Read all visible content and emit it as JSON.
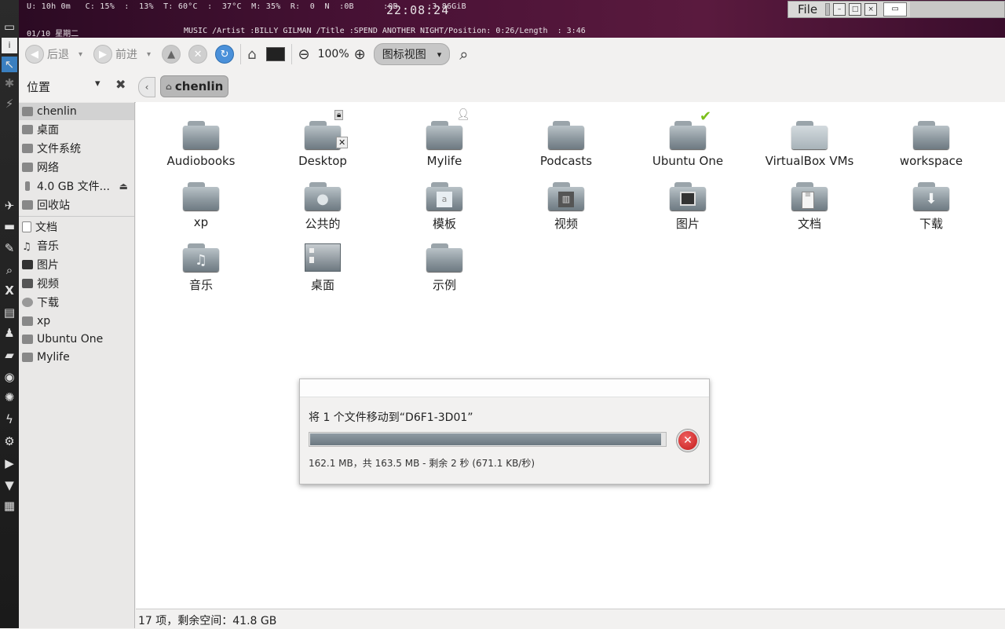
{
  "topbar": {
    "stats": "U: 10h 0m   C: 15%  :  13%  T: 60°C  :  37°C  M: 35%  R:  0  N  :0B      :0B      :3.86GiB",
    "clock": "22:08:24",
    "date": "01/10  星期二",
    "music": "MUSIC /Artist :BILLY GILMAN /Title :SPEND ANOTHER NIGHT/Position: 0:26/Length  : 3:46"
  },
  "menubar": {
    "file_label": "File"
  },
  "toolbar": {
    "back_label": "后退",
    "forward_label": "前进",
    "zoom_level": "100%",
    "view_mode": "图标视图"
  },
  "location": {
    "places_title": "位置",
    "crumb": "chenlin"
  },
  "sidebar": {
    "items": [
      {
        "label": "chenlin",
        "icon": "home-folder-icon"
      },
      {
        "label": "桌面",
        "icon": "desktop-icon"
      },
      {
        "label": "文件系统",
        "icon": "filesystem-icon"
      },
      {
        "label": "网络",
        "icon": "network-icon"
      },
      {
        "label": "4.0 GB 文件...",
        "icon": "usb-drive-icon"
      },
      {
        "label": "回收站",
        "icon": "trash-icon"
      },
      {
        "label": "文档",
        "icon": "documents-icon"
      },
      {
        "label": "音乐",
        "icon": "music-icon"
      },
      {
        "label": "图片",
        "icon": "pictures-icon"
      },
      {
        "label": "视频",
        "icon": "videos-icon"
      },
      {
        "label": "下载",
        "icon": "downloads-icon"
      },
      {
        "label": "xp",
        "icon": "folder-icon"
      },
      {
        "label": "Ubuntu One",
        "icon": "folder-icon"
      },
      {
        "label": "Mylife",
        "icon": "folder-icon"
      }
    ]
  },
  "files": [
    {
      "name": "Audiobooks",
      "icon": "folder-icon"
    },
    {
      "name": "Desktop",
      "icon": "folder-icon"
    },
    {
      "name": "Mylife",
      "icon": "folder-icon"
    },
    {
      "name": "Podcasts",
      "icon": "folder-icon"
    },
    {
      "name": "Ubuntu One",
      "icon": "folder-icon"
    },
    {
      "name": "VirtualBox VMs",
      "icon": "folder-icon"
    },
    {
      "name": "workspace",
      "icon": "folder-icon"
    },
    {
      "name": "xp",
      "icon": "folder-icon"
    },
    {
      "name": "公共的",
      "icon": "public-folder-icon"
    },
    {
      "name": "模板",
      "icon": "templates-folder-icon"
    },
    {
      "name": "视频",
      "icon": "videos-folder-icon"
    },
    {
      "name": "图片",
      "icon": "pictures-folder-icon"
    },
    {
      "name": "文档",
      "icon": "documents-folder-icon"
    },
    {
      "name": "下载",
      "icon": "downloads-folder-icon"
    },
    {
      "name": "音乐",
      "icon": "music-folder-icon"
    },
    {
      "name": "桌面",
      "icon": "desktop-thumbnail-icon"
    },
    {
      "name": "示例",
      "icon": "folder-icon"
    }
  ],
  "dialog": {
    "message": "将 1 个文件移动到“D6F1-3D01”",
    "progress": 0.99,
    "status": "162.1 MB，共 163.5 MB - 剩余 2 秒 (671.1 KB/秒)"
  },
  "statusbar": {
    "text": "17 项，剩余空间：41.8 GB"
  },
  "colors": {
    "panel_bg": "#f2f1f0",
    "desktop_purple": "#4a1236",
    "progress": "#7d8990",
    "cancel_red": "#d42b2b"
  }
}
